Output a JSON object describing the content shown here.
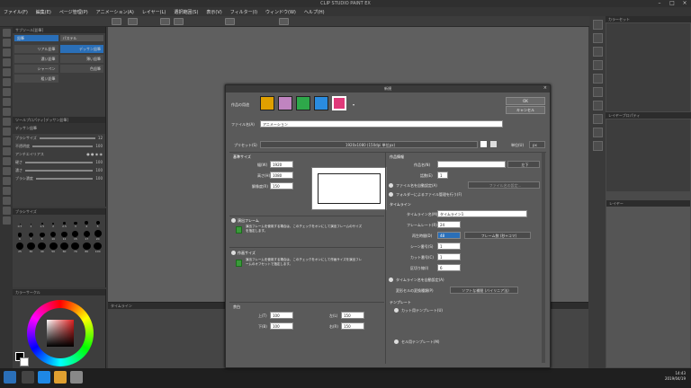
{
  "app": {
    "title": "CLIP STUDIO PAINT EX",
    "menu": [
      "ファイル(F)",
      "編集(E)",
      "ページ管理(P)",
      "アニメーション(A)",
      "レイヤー(L)",
      "選択範囲(S)",
      "表示(V)",
      "フィルター(I)",
      "ウィンドウ(W)",
      "ヘルプ(H)"
    ]
  },
  "subtool": {
    "header": "サブツール[鉛筆]",
    "tabs": [
      "鉛筆",
      "パステル"
    ],
    "items": [
      "リアル鉛筆",
      "デッサン鉛筆",
      "濃い鉛筆",
      "薄い鉛筆",
      "シャーペン",
      "色鉛筆",
      "粗い鉛筆"
    ],
    "selected": "デッサン鉛筆"
  },
  "tool_property": {
    "header": "ツールプロパティ[デッサン鉛筆]",
    "brush_name": "デッサン鉛筆",
    "rows": [
      {
        "label": "ブラシサイズ",
        "value": "12"
      },
      {
        "label": "不透明度",
        "value": "100"
      },
      {
        "label": "アンチエイリアス",
        "value": ""
      },
      {
        "label": "硬さ",
        "value": "100"
      },
      {
        "label": "濃さ",
        "value": "100"
      },
      {
        "label": "ブラシ濃度",
        "value": "100"
      }
    ]
  },
  "brush_size": {
    "header": "ブラシサイズ",
    "sizes": [
      "0.7",
      "1",
      "1.5",
      "2",
      "2.5",
      "3",
      "4",
      "5",
      "6",
      "7",
      "8",
      "10",
      "12",
      "15",
      "17",
      "20",
      "25",
      "30",
      "40",
      "50",
      "60",
      "70",
      "80",
      "100"
    ]
  },
  "color_panel": {
    "header": "カラーサークル"
  },
  "timeline": {
    "header": "タイムライン"
  },
  "right_panel": {
    "color_header": "カラーセット",
    "layer_header": "レイヤー",
    "layer_prop_header": "レイヤープロパティ"
  },
  "dialog": {
    "title": "新規",
    "close": "×",
    "ok": "OK",
    "cancel": "キャンセル",
    "purpose_label": "作品の用途",
    "filename_label": "ファイル名(A)",
    "filename_value": "アニメーション",
    "preset_label": "プリセット(S)",
    "preset_value": "1920x1080 (150dpi 単位px)",
    "unit_label": "単位(U)",
    "unit_value": "px",
    "basic_size_header": "基準サイズ",
    "width_label": "幅(W)",
    "width_value": "1920",
    "height_label": "高さ(H)",
    "height_value": "1080",
    "resolution_label": "解像度(R)",
    "resolution_value": "150",
    "frame_header": "演出フレーム",
    "frame_hint": "演出フレームを使用する場合は、このチェックをオンにして演出フレームのサイズを指定します。",
    "canvas_header": "作画サイズ",
    "canvas_hint": "演出フレームを使用する場合は、このチェックをオンにして作画サイズを演出フレームのオフセットで指定します。",
    "margin_header": "余白",
    "margin_top_label": "上(T)",
    "margin_top_value": "100",
    "margin_left_label": "左(L)",
    "margin_left_value": "150",
    "margin_bottom_label": "下(B)",
    "margin_bottom_value": "100",
    "margin_right_label": "右(R)",
    "margin_right_value": "150",
    "info_header": "作品情報",
    "work_name_label": "作品名(N)",
    "work_name_btn": "左下",
    "episode_label": "話数(E)",
    "episode_value": "1",
    "file_settings_label": "ファイル名を自動設定(A)",
    "file_settings_btn": "ファイル名の設定...",
    "folder_label": "フォルダーによるファイル管理を行う(F)",
    "timeline_header": "タイムライン",
    "timeline_name_label": "タイムライン名(M)",
    "timeline_name_value": "タイムライン1",
    "framerate_label": "フレームレート(R)",
    "framerate_value": "24",
    "playback_label": "再生時間(D)",
    "playback_value": "48",
    "playback_unit": "フレーム数 (秒+コマ)",
    "scene_label": "シーン番号(S)",
    "scene_value": "1",
    "cut_label": "カット番号(C)",
    "cut_value": "1",
    "section_label": "区切り線(I)",
    "section_value": "6",
    "auto_name_label": "タイムライン名を自動設定(A)",
    "cel_type_label": "変形セルの変換種類(P)",
    "cel_type_value": "ソフトな補間 (バイリニア法)",
    "template_header": "テンプレート",
    "cut_template_label": "カット用テンプレート(U)",
    "cel_template_label": "セル用テンプレート(M)"
  },
  "taskbar": {
    "time": "14:43",
    "date": "2019/04/19"
  },
  "colors": {
    "accent": "#2a6fb8",
    "dialog_bg": "#5a5a5a",
    "canvas_bg": "#5f5f5f"
  }
}
